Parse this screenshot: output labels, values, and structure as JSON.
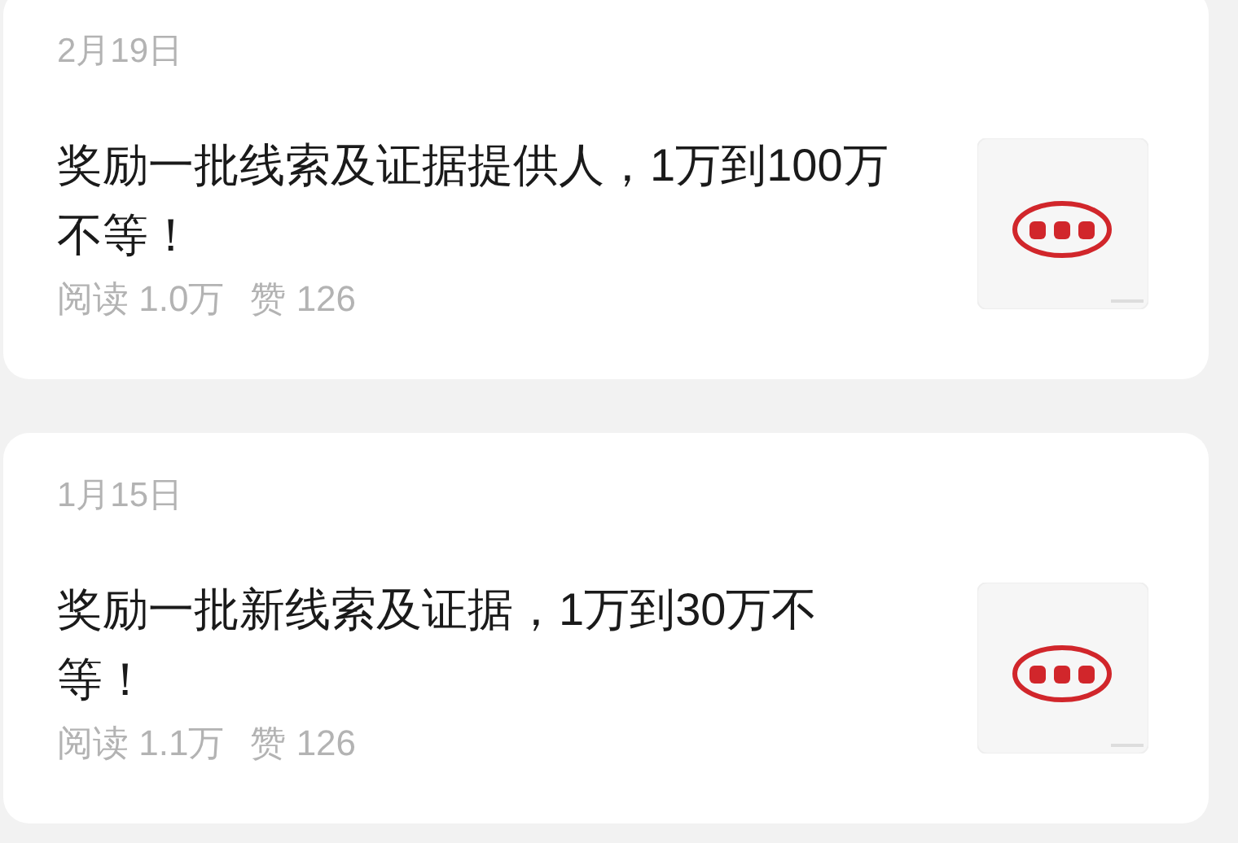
{
  "articles": [
    {
      "date": "2月19日",
      "title": "奖励一批线索及证据提供人，1万到100万不等！",
      "reads": "阅读 1.0万",
      "likes": "赞 126"
    },
    {
      "date": "1月15日",
      "title": "奖励一批新线索及证据，1万到30万不等！",
      "reads": "阅读 1.1万",
      "likes": "赞 126"
    }
  ]
}
